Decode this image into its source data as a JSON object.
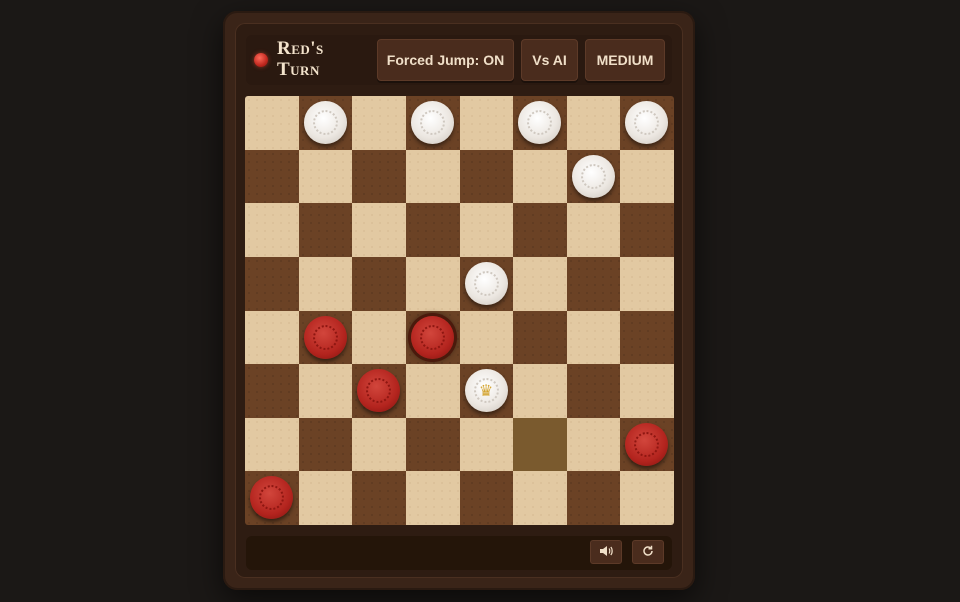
{
  "header": {
    "turn_label": "Red's Turn",
    "forced_jump_label": "Forced Jump: ON",
    "mode_label": "Vs AI",
    "difficulty_label": "MEDIUM"
  },
  "footer": {
    "sound_icon": "speaker-icon",
    "restart_icon": "restart-icon"
  },
  "colors": {
    "red_piece": "#b3241e",
    "white_piece": "#ece7e1",
    "dark_square": "#6b4225",
    "light_square": "#e2c9a2"
  },
  "board": {
    "pieces": [
      {
        "row": 0,
        "col": 1,
        "color": "white",
        "king": false
      },
      {
        "row": 0,
        "col": 3,
        "color": "white",
        "king": false
      },
      {
        "row": 0,
        "col": 5,
        "color": "white",
        "king": false
      },
      {
        "row": 0,
        "col": 7,
        "color": "white",
        "king": false
      },
      {
        "row": 1,
        "col": 6,
        "color": "white",
        "king": false
      },
      {
        "row": 3,
        "col": 4,
        "color": "white",
        "king": false
      },
      {
        "row": 4,
        "col": 1,
        "color": "red",
        "king": false
      },
      {
        "row": 4,
        "col": 3,
        "color": "red",
        "king": false,
        "selected": true
      },
      {
        "row": 5,
        "col": 2,
        "color": "red",
        "king": false
      },
      {
        "row": 5,
        "col": 4,
        "color": "white",
        "king": true
      },
      {
        "row": 6,
        "col": 7,
        "color": "red",
        "king": false
      },
      {
        "row": 7,
        "col": 0,
        "color": "red",
        "king": false
      }
    ],
    "highlight": {
      "row": 6,
      "col": 5
    }
  }
}
